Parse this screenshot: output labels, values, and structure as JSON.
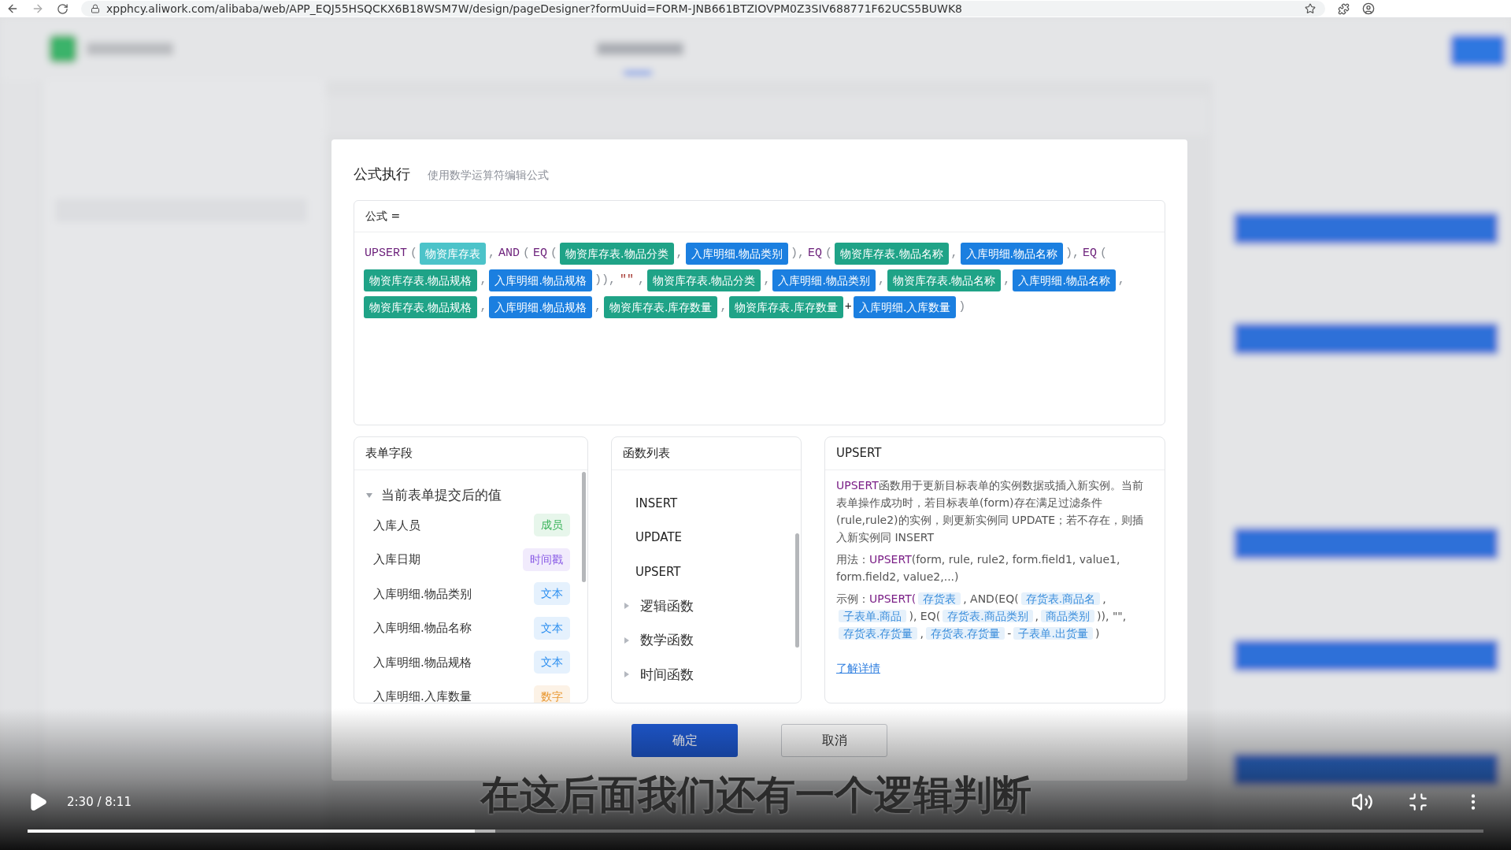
{
  "browser": {
    "url": "xpphcy.aliwork.com/alibaba/web/APP_EQJ55HSQCKX6B18WSM7W/design/pageDesigner?formUuid=FORM-JNB661BTZIOVPM0Z3SIV688771F62UCS5BUWK8"
  },
  "dialog": {
    "title": "公式执行",
    "subtitle": "使用数学运算符编辑公式",
    "formula": {
      "label": "公式 =",
      "tokens": [
        {
          "kind": "fn",
          "text": "UPSERT"
        },
        {
          "kind": "punct",
          "text": "("
        },
        {
          "kind": "table",
          "text": "物资库存表"
        },
        {
          "kind": "punct",
          "text": ","
        },
        {
          "kind": "fn",
          "text": "AND"
        },
        {
          "kind": "punct",
          "text": "("
        },
        {
          "kind": "fn",
          "text": "EQ"
        },
        {
          "kind": "punct",
          "text": "("
        },
        {
          "kind": "main",
          "text": "物资库存表.物品分类"
        },
        {
          "kind": "punct",
          "text": ","
        },
        {
          "kind": "sub",
          "text": "入库明细.物品类别"
        },
        {
          "kind": "punct",
          "text": "),"
        },
        {
          "kind": "fn",
          "text": "EQ"
        },
        {
          "kind": "punct",
          "text": "("
        },
        {
          "kind": "main",
          "text": "物资库存表.物品名称"
        },
        {
          "kind": "punct",
          "text": ","
        },
        {
          "kind": "sub",
          "text": "入库明细.物品名称"
        },
        {
          "kind": "punct",
          "text": "),"
        },
        {
          "kind": "fn",
          "text": "EQ"
        },
        {
          "kind": "punct",
          "text": "("
        },
        {
          "kind": "main",
          "text": "物资库存表.物品规格"
        },
        {
          "kind": "punct",
          "text": ","
        },
        {
          "kind": "sub",
          "text": "入库明细.物品规格"
        },
        {
          "kind": "punct",
          "text": ")),"
        },
        {
          "kind": "string",
          "text": "\"\""
        },
        {
          "kind": "punct",
          "text": ","
        },
        {
          "kind": "main",
          "text": "物资库存表.物品分类"
        },
        {
          "kind": "punct",
          "text": ","
        },
        {
          "kind": "sub",
          "text": "入库明细.物品类别"
        },
        {
          "kind": "punct",
          "text": ","
        },
        {
          "kind": "main",
          "text": "物资库存表.物品名称"
        },
        {
          "kind": "punct",
          "text": ","
        },
        {
          "kind": "sub",
          "text": "入库明细.物品名称"
        },
        {
          "kind": "punct",
          "text": ","
        },
        {
          "kind": "main",
          "text": "物资库存表.物品规格"
        },
        {
          "kind": "punct",
          "text": ","
        },
        {
          "kind": "sub",
          "text": "入库明细.物品规格"
        },
        {
          "kind": "punct",
          "text": ","
        },
        {
          "kind": "main",
          "text": "物资库存表.库存数量"
        },
        {
          "kind": "punct",
          "text": ","
        },
        {
          "kind": "main",
          "text": "物资库存表.库存数量"
        },
        {
          "kind": "op",
          "text": "+"
        },
        {
          "kind": "sub",
          "text": "入库明细.入库数量"
        },
        {
          "kind": "punct",
          "text": ")"
        }
      ]
    },
    "fields": {
      "title": "表单字段",
      "groups": [
        {
          "label": "当前表单提交后的值",
          "expanded": true,
          "items": [
            {
              "name": "入库人员",
              "type": "成员",
              "color": "#3cb55c"
            },
            {
              "name": "入库日期",
              "type": "时间戳",
              "color": "#8a5ce6"
            },
            {
              "name": "入库明细.物品类别",
              "type": "文本",
              "color": "#2a8ef0"
            },
            {
              "name": "入库明细.物品名称",
              "type": "文本",
              "color": "#2a8ef0"
            },
            {
              "name": "入库明细.物品规格",
              "type": "文本",
              "color": "#2a8ef0"
            },
            {
              "name": "入库明细.入库数量",
              "type": "数字",
              "color": "#e8962e"
            }
          ]
        }
      ]
    },
    "functions": {
      "title": "函数列表",
      "items": [
        {
          "kind": "function",
          "label": "INSERT"
        },
        {
          "kind": "function",
          "label": "UPDATE"
        },
        {
          "kind": "function",
          "label": "UPSERT"
        },
        {
          "kind": "category",
          "label": "逻辑函数",
          "expanded": false
        },
        {
          "kind": "category",
          "label": "数学函数",
          "expanded": false
        },
        {
          "kind": "category",
          "label": "时间函数",
          "expanded": false
        }
      ]
    },
    "help": {
      "title": "UPSERT",
      "description": [
        {
          "kind": "fn",
          "text": "UPSERT"
        },
        {
          "kind": "text",
          "text": "函数用于更新目标表单的实例数据或插入新实例。当前表单操作成功时，若目标表单(form)存在满足过滤条件(rule,rule2)的实例，则更新实例同 UPDATE；若不存在，则插入新实例同 INSERT"
        }
      ],
      "usage": [
        {
          "kind": "text",
          "text": "用法："
        },
        {
          "kind": "fn",
          "text": "UPSERT"
        },
        {
          "kind": "text",
          "text": "(form, rule, rule2, form.field1, value1, form.field2, value2,...)"
        }
      ],
      "example": [
        {
          "kind": "text",
          "text": "示例："
        },
        {
          "kind": "fn",
          "text": "UPSERT("
        },
        {
          "kind": "chip",
          "text": "存货表"
        },
        {
          "kind": "text",
          "text": ", AND(EQ("
        },
        {
          "kind": "chip",
          "text": "存货表.商品名"
        },
        {
          "kind": "text",
          "text": ","
        },
        {
          "kind": "chip",
          "text": "子表单.商品"
        },
        {
          "kind": "text",
          "text": "), EQ("
        },
        {
          "kind": "chip",
          "text": "存货表.商品类别"
        },
        {
          "kind": "text",
          "text": ","
        },
        {
          "kind": "chip",
          "text": "商品类别"
        },
        {
          "kind": "text",
          "text": ")), \"\","
        },
        {
          "kind": "chip",
          "text": "存货表.存货量"
        },
        {
          "kind": "text",
          "text": ","
        },
        {
          "kind": "chip",
          "text": "存货表.存货量"
        },
        {
          "kind": "text",
          "text": "-"
        },
        {
          "kind": "chip",
          "text": "子表单.出货量"
        },
        {
          "kind": "text",
          "text": ")"
        }
      ],
      "link": "了解详情"
    },
    "buttons": [
      {
        "kind": "primary",
        "label": "确定"
      },
      {
        "kind": "default",
        "label": "取消"
      }
    ]
  },
  "player": {
    "subtitle": "在这后面我们还有一个逻辑判断",
    "time": "2:30 / 8:11",
    "level": 0.307
  }
}
